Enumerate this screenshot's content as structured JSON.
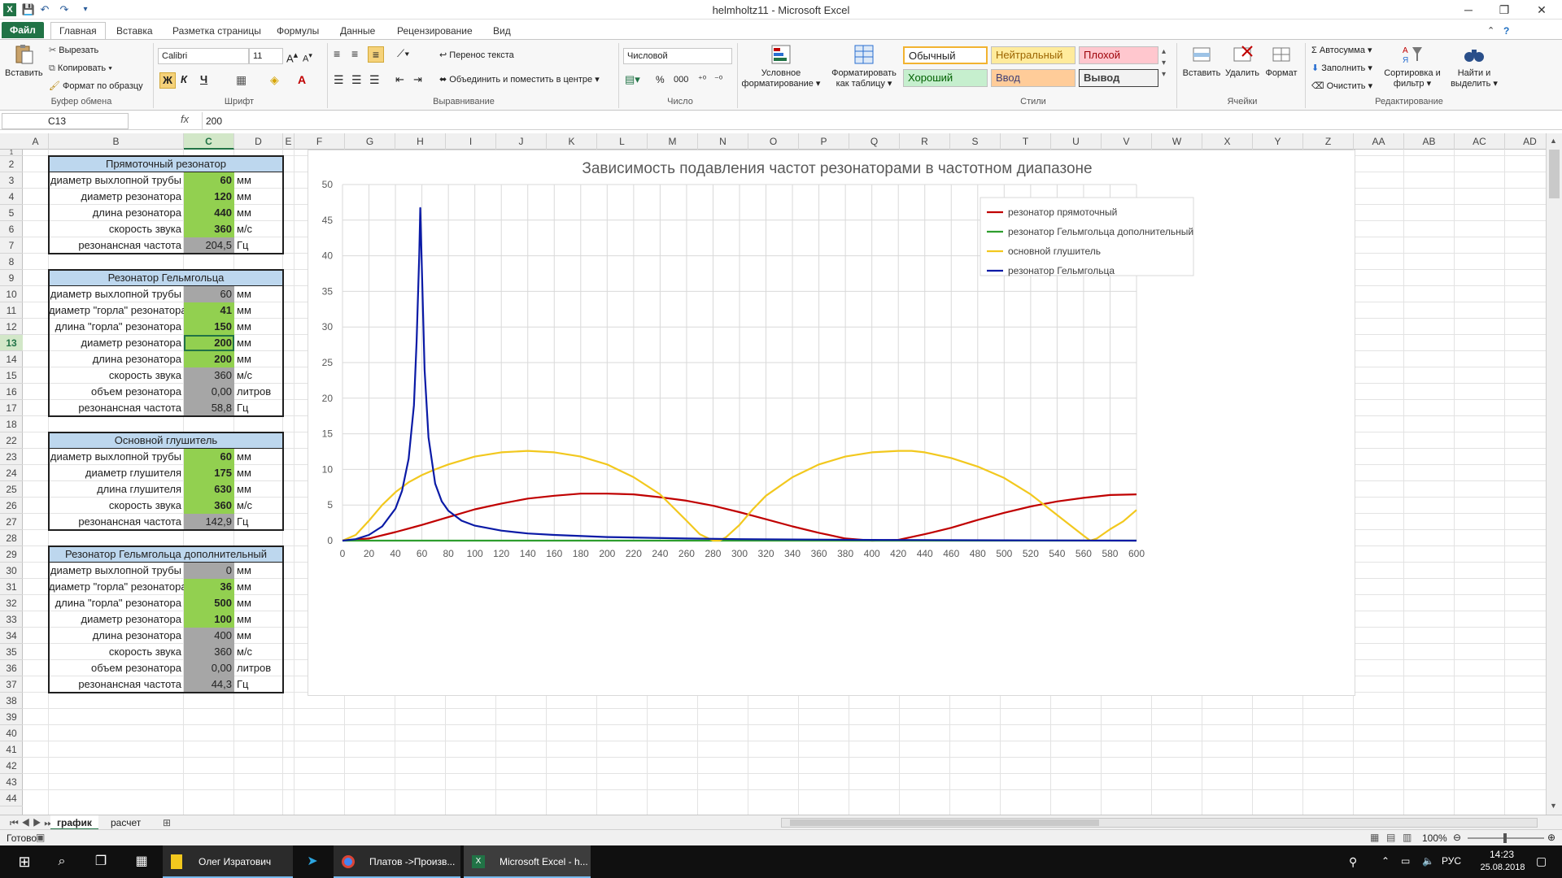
{
  "window": {
    "title": "helmholtz11 - Microsoft Excel"
  },
  "ribbon_tabs": [
    {
      "label": "Файл"
    },
    {
      "label": "Главная"
    },
    {
      "label": "Вставка"
    },
    {
      "label": "Разметка страницы"
    },
    {
      "label": "Формулы"
    },
    {
      "label": "Данные"
    },
    {
      "label": "Рецензирование"
    },
    {
      "label": "Вид"
    }
  ],
  "ribbon": {
    "clipboard": {
      "paste": "Вставить",
      "cut": "Вырезать",
      "copy": "Копировать",
      "format_painter": "Формат по образцу",
      "group": "Буфер обмена"
    },
    "font": {
      "name": "Calibri",
      "size": "11",
      "bold": "Ж",
      "italic": "К",
      "underline": "Ч",
      "group": "Шрифт"
    },
    "alignment": {
      "wrap": "Перенос текста",
      "merge": "Объединить и поместить в центре",
      "group": "Выравнивание"
    },
    "number": {
      "format": "Числовой",
      "percent": "%",
      "thousands": "000",
      "group": "Число"
    },
    "cond_format": "Условное форматирование",
    "format_table": "Форматировать как таблицу",
    "styles": {
      "normal": "Обычный",
      "neutral": "Нейтральный",
      "bad": "Плохой",
      "good": "Хороший",
      "input": "Ввод",
      "output": "Вывод",
      "group": "Стили"
    },
    "cells": {
      "insert": "Вставить",
      "delete": "Удалить",
      "format": "Формат",
      "group": "Ячейки"
    },
    "editing": {
      "autosum": "Автосумма",
      "fill": "Заполнить",
      "clear": "Очистить",
      "sort": "Сортировка и фильтр",
      "find": "Найти и выделить",
      "group": "Редактирование"
    }
  },
  "formula_bar": {
    "name_box": "C13",
    "fx": "fx",
    "value": "200"
  },
  "columns": [
    "A",
    "B",
    "C",
    "D",
    "E",
    "F",
    "G",
    "H",
    "I",
    "J",
    "K",
    "L",
    "M",
    "N",
    "O",
    "P",
    "Q",
    "R",
    "S",
    "T",
    "U",
    "V",
    "W",
    "X",
    "Y",
    "Z",
    "AA",
    "AB",
    "AC",
    "AD"
  ],
  "rows": [
    "1",
    "2",
    "3",
    "4",
    "5",
    "6",
    "7",
    "8",
    "9",
    "10",
    "11",
    "12",
    "13",
    "14",
    "15",
    "16",
    "17",
    "18",
    "22",
    "23",
    "24",
    "25",
    "26",
    "27",
    "28",
    "29",
    "30",
    "31",
    "32",
    "33",
    "34",
    "35",
    "36",
    "37",
    "38",
    "39",
    "40",
    "41",
    "42",
    "43",
    "44"
  ],
  "tables": [
    {
      "title": "Прямоточный резонатор",
      "rows": [
        {
          "label": "диаметр выхлопной трубы",
          "value": "60",
          "unit": "мм",
          "fill": "green"
        },
        {
          "label": "диаметр резонатора",
          "value": "120",
          "unit": "мм",
          "fill": "green"
        },
        {
          "label": "длина резонатора",
          "value": "440",
          "unit": "мм",
          "fill": "green"
        },
        {
          "label": "скорость звука",
          "value": "360",
          "unit": "м/с",
          "fill": "green"
        },
        {
          "label": "резонансная частота",
          "value": "204,5",
          "unit": "Гц",
          "fill": "gray"
        }
      ]
    },
    {
      "title": "Резонатор Гельмгольца",
      "rows": [
        {
          "label": "диаметр выхлопной трубы",
          "value": "60",
          "unit": "мм",
          "fill": "gray"
        },
        {
          "label": "диаметр \"горла\" резонатора",
          "value": "41",
          "unit": "мм",
          "fill": "green"
        },
        {
          "label": "длина \"горла\" резонатора",
          "value": "150",
          "unit": "мм",
          "fill": "green"
        },
        {
          "label": "диаметр резонатора",
          "value": "200",
          "unit": "мм",
          "fill": "green"
        },
        {
          "label": "длина резонатора",
          "value": "200",
          "unit": "мм",
          "fill": "green"
        },
        {
          "label": "скорость звука",
          "value": "360",
          "unit": "м/с",
          "fill": "gray"
        },
        {
          "label": "объем резонатора",
          "value": "0,00",
          "unit": "литров",
          "fill": "gray"
        },
        {
          "label": "резонансная частота",
          "value": "58,8",
          "unit": "Гц",
          "fill": "gray"
        }
      ]
    },
    {
      "title": "Основной глушитель",
      "rows": [
        {
          "label": "диаметр выхлопной трубы",
          "value": "60",
          "unit": "мм",
          "fill": "green"
        },
        {
          "label": "диаметр глушителя",
          "value": "175",
          "unit": "мм",
          "fill": "green"
        },
        {
          "label": "длина глушителя",
          "value": "630",
          "unit": "мм",
          "fill": "green"
        },
        {
          "label": "скорость звука",
          "value": "360",
          "unit": "м/с",
          "fill": "green"
        },
        {
          "label": "резонансная частота",
          "value": "142,9",
          "unit": "Гц",
          "fill": "gray"
        }
      ]
    },
    {
      "title": "Резонатор Гельмгольца дополнительный",
      "rows": [
        {
          "label": "диаметр выхлопной трубы",
          "value": "0",
          "unit": "мм",
          "fill": "gray"
        },
        {
          "label": "диаметр \"горла\" резонатора",
          "value": "36",
          "unit": "мм",
          "fill": "green"
        },
        {
          "label": "длина \"горла\" резонатора",
          "value": "500",
          "unit": "мм",
          "fill": "green"
        },
        {
          "label": "диаметр резонатора",
          "value": "100",
          "unit": "мм",
          "fill": "green"
        },
        {
          "label": "длина резонатора",
          "value": "400",
          "unit": "мм",
          "fill": "gray"
        },
        {
          "label": "скорость звука",
          "value": "360",
          "unit": "м/с",
          "fill": "gray"
        },
        {
          "label": "объем резонатора",
          "value": "0,00",
          "unit": "литров",
          "fill": "gray"
        },
        {
          "label": "резонансная частота",
          "value": "44,3",
          "unit": "Гц",
          "fill": "gray"
        }
      ]
    }
  ],
  "chart_data": {
    "type": "line",
    "title": "Зависимость подавления частот резонаторами в частотном диапазоне",
    "xlim": [
      0,
      600
    ],
    "ylim": [
      0,
      50
    ],
    "x_ticks": [
      0,
      20,
      40,
      60,
      80,
      100,
      120,
      140,
      160,
      180,
      200,
      220,
      240,
      260,
      280,
      300,
      320,
      340,
      360,
      380,
      400,
      420,
      440,
      460,
      480,
      500,
      520,
      540,
      560,
      580,
      600
    ],
    "y_ticks": [
      0,
      5,
      10,
      15,
      20,
      25,
      30,
      35,
      40,
      45,
      50
    ],
    "grid": true,
    "legend_position": "top-right",
    "series": [
      {
        "name": "резонатор прямоточный",
        "color": "#c00000",
        "x": [
          0,
          20,
          40,
          60,
          80,
          100,
          120,
          140,
          160,
          180,
          200,
          220,
          240,
          260,
          280,
          300,
          320,
          340,
          360,
          380,
          400,
          420,
          440,
          460,
          480,
          500,
          520,
          540,
          560,
          580,
          600
        ],
        "values": [
          0,
          0.3,
          1.2,
          2.2,
          3.3,
          4.4,
          5.2,
          5.9,
          6.3,
          6.6,
          6.6,
          6.5,
          6.1,
          5.6,
          4.9,
          4.0,
          3.0,
          2.0,
          1.1,
          0.3,
          0,
          0.1,
          0.9,
          1.8,
          2.9,
          3.9,
          4.8,
          5.5,
          6.0,
          6.4,
          6.5
        ]
      },
      {
        "name": "резонатор Гельмгольца дополнительный",
        "color": "#2e9e2e",
        "x": [
          0,
          600
        ],
        "values": [
          0,
          0
        ]
      },
      {
        "name": "основной глушитель",
        "color": "#f2c81e",
        "x": [
          0,
          10,
          20,
          30,
          40,
          50,
          60,
          70,
          80,
          100,
          120,
          140,
          160,
          180,
          200,
          220,
          240,
          260,
          270,
          280,
          285,
          290,
          300,
          310,
          320,
          340,
          360,
          380,
          400,
          420,
          430,
          440,
          460,
          480,
          500,
          520,
          540,
          560,
          565,
          570,
          580,
          590,
          600
        ],
        "values": [
          0,
          0.8,
          2.8,
          5.0,
          6.8,
          8.2,
          9.2,
          10.0,
          10.7,
          11.8,
          12.4,
          12.6,
          12.4,
          11.8,
          10.7,
          8.9,
          6.5,
          2.8,
          0.9,
          0,
          0,
          0.5,
          2.2,
          4.4,
          6.3,
          8.9,
          10.7,
          11.8,
          12.4,
          12.6,
          12.6,
          12.4,
          11.6,
          10.4,
          8.8,
          6.5,
          3.6,
          0.7,
          0,
          0.3,
          1.6,
          2.7,
          4.3
        ]
      },
      {
        "name": "резонатор Гельмгольца",
        "color": "#0a1aa6",
        "x": [
          0,
          10,
          20,
          30,
          40,
          45,
          50,
          54,
          56,
          58,
          58.8,
          60,
          62,
          65,
          70,
          75,
          80,
          90,
          100,
          120,
          140,
          160,
          200,
          260,
          300,
          400,
          500,
          600
        ],
        "values": [
          0,
          0.2,
          0.8,
          2.0,
          4.5,
          7.0,
          11.5,
          19.0,
          28.0,
          40.0,
          46.7,
          38.0,
          24.0,
          14.5,
          8.0,
          5.5,
          4.2,
          2.8,
          2.1,
          1.4,
          1.0,
          0.8,
          0.5,
          0.3,
          0.2,
          0.1,
          0.05,
          0
        ]
      }
    ]
  },
  "sheet_tabs": [
    {
      "label": "график",
      "active": true
    },
    {
      "label": "расчет",
      "active": false
    }
  ],
  "status": {
    "ready": "Готово",
    "zoom": "100%"
  },
  "taskbar": {
    "apps": [
      {
        "label": "Олег Изратович"
      },
      {
        "label": "Платов ->Произв..."
      },
      {
        "label": "Microsoft Excel - h..."
      }
    ],
    "lang": "РУС",
    "time": "14:23",
    "date": "25.08.2018"
  }
}
